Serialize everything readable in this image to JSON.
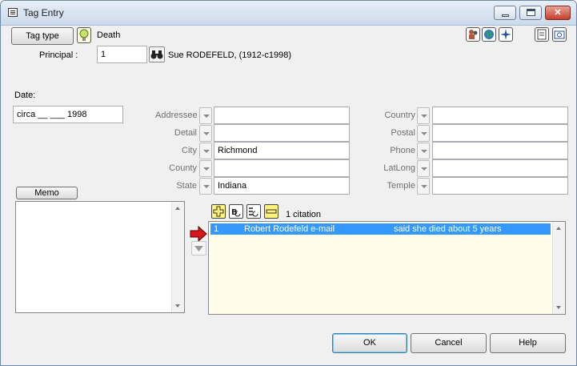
{
  "window": {
    "title": "Tag Entry"
  },
  "tag": {
    "type_button": "Tag type",
    "type_value": "Death"
  },
  "principal": {
    "label": "Principal :",
    "number": "1",
    "name": "Sue RODEFELD, (1912-c1998)"
  },
  "date": {
    "label": "Date:",
    "value": "circa __ ___ 1998"
  },
  "place_fields": [
    {
      "label": "Addressee",
      "value": ""
    },
    {
      "label": "Detail",
      "value": ""
    },
    {
      "label": "City",
      "value": "Richmond"
    },
    {
      "label": "County",
      "value": ""
    },
    {
      "label": "State",
      "value": "Indiana"
    }
  ],
  "place_fields_right": [
    {
      "label": "Country",
      "value": ""
    },
    {
      "label": "Postal",
      "value": ""
    },
    {
      "label": "Phone",
      "value": ""
    },
    {
      "label": "LatLong",
      "value": ""
    },
    {
      "label": "Temple",
      "value": ""
    }
  ],
  "memo": {
    "button": "Memo",
    "text": ""
  },
  "citations": {
    "count_text": "1  citation",
    "rows": [
      {
        "num": "1",
        "source": "Robert Rodefeld e-mail",
        "detail": "said she died about 5 years"
      }
    ]
  },
  "buttons": {
    "ok": "OK",
    "cancel": "Cancel",
    "help": "Help"
  },
  "icons": {
    "tag_type": "lightbulb-icon",
    "principal_lookup": "binoculars-icon",
    "top_right": [
      "people-icon",
      "globe-icon",
      "compass-icon",
      "notepad-icon",
      "camera-icon"
    ],
    "citation_tools": [
      "add-icon",
      "edit-citation-icon",
      "edit-list-icon",
      "remove-icon"
    ]
  }
}
